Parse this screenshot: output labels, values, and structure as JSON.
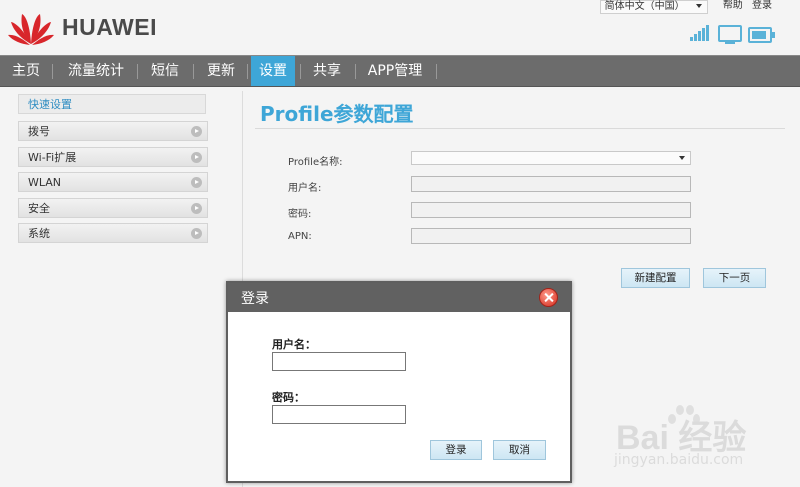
{
  "brand": {
    "name": "HUAWEI"
  },
  "toplinks": {
    "language": "简体中文（中国）",
    "help": "帮助",
    "login": "登录"
  },
  "nav": [
    "主页",
    "流量统计",
    "短信",
    "更新",
    "设置",
    "共享",
    "APP管理"
  ],
  "nav_active": "设置",
  "sidebar": {
    "quick": "快速设置",
    "items": [
      "拨号",
      "Wi-Fi扩展",
      "WLAN",
      "安全",
      "系统"
    ]
  },
  "main": {
    "title": "Profile参数配置",
    "fields": {
      "profile_name": "Profile名称:",
      "username": "用户名:",
      "password": "密码:",
      "apn": "APN:"
    },
    "buttons": {
      "new_config": "新建配置",
      "next": "下一页"
    }
  },
  "login_dialog": {
    "title": "登录",
    "username_label": "用户名：",
    "password_label": "密码：",
    "login_button": "登录",
    "cancel_button": "取消"
  },
  "watermark": {
    "main": "Bai 经验",
    "sub": "jingyan.baidu.com"
  },
  "colors": {
    "accent": "#3ea6d7",
    "nav_bg": "#6c6c6c",
    "brand_red": "#d8262b"
  }
}
